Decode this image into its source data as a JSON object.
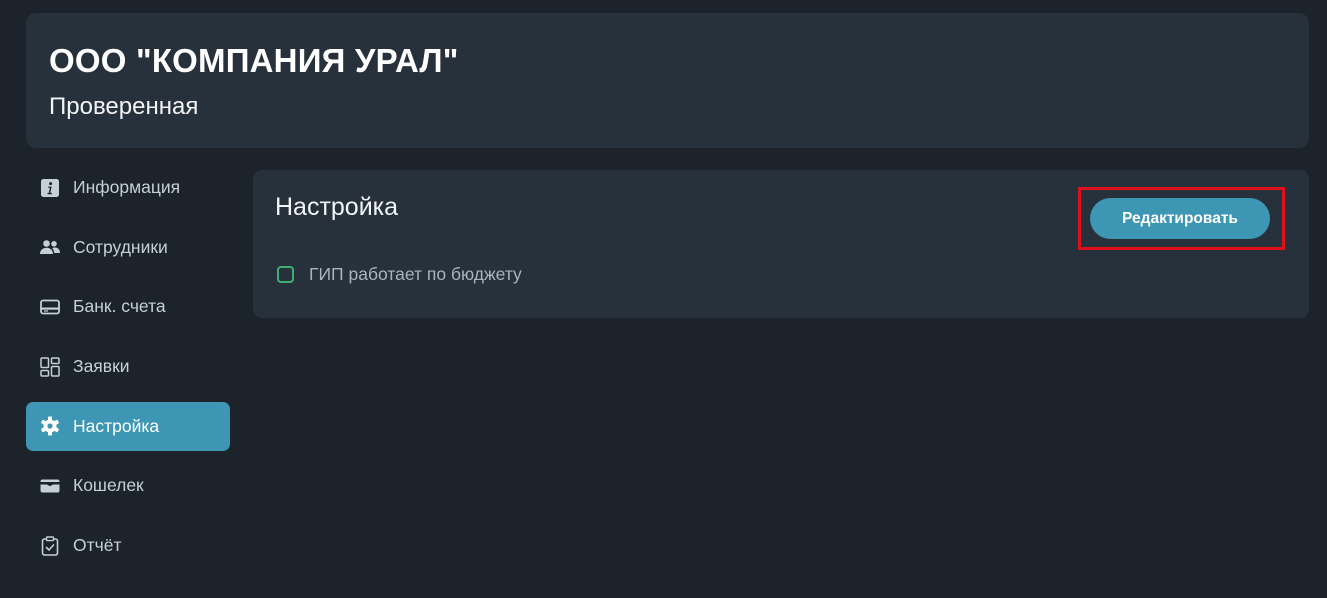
{
  "company": {
    "name": "ООО \"КОМПАНИЯ УРАЛ\"",
    "status": "Проверенная"
  },
  "sidebar": {
    "items": [
      {
        "label": "Информация",
        "icon": "info-icon",
        "active": false
      },
      {
        "label": "Сотрудники",
        "icon": "users-icon",
        "active": false
      },
      {
        "label": "Банк. счета",
        "icon": "credit-card-icon",
        "active": false
      },
      {
        "label": "Заявки",
        "icon": "dashboard-grid-icon",
        "active": false
      },
      {
        "label": "Настройка",
        "icon": "gear-icon",
        "active": true
      },
      {
        "label": "Кошелек",
        "icon": "wallet-icon",
        "active": false
      },
      {
        "label": "Отчёт",
        "icon": "clipboard-check-icon",
        "active": false
      }
    ]
  },
  "settings": {
    "title": "Настройка",
    "edit_button": "Редактировать",
    "checkbox_label": "ГИП работает по бюджету",
    "checkbox_checked": false
  },
  "colors": {
    "background": "#1c232a",
    "card": "#27313b",
    "accent": "#3d97b4",
    "checkbox_border": "#3fae6e",
    "highlight": "#e0101a"
  }
}
